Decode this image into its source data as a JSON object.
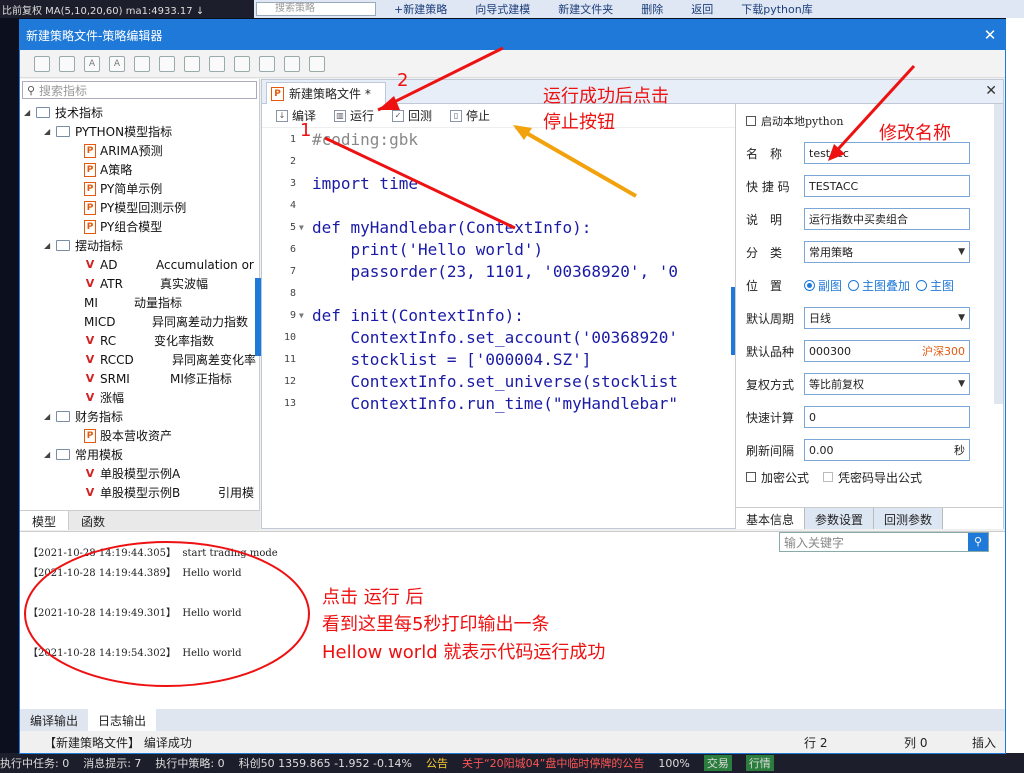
{
  "background": {
    "ticker": "比前复权 MA(5,10,20,60) ma1:4933.17 ↓",
    "search_placeholder": "搜索策略",
    "toolbar": [
      "+新建策略",
      "向导式建模",
      "新建文件夹",
      "删除",
      "返回",
      "下载python库"
    ],
    "status": [
      "执行中任务: 0",
      "消息提示: 7",
      "执行中策略: 0",
      "科创50 1359.865 -1.952 -0.14%",
      "公告",
      "关于“20阳城04”盘中临时停牌的公告",
      "100%",
      "交易",
      "行情"
    ]
  },
  "window": {
    "title": "新建策略文件-策略编辑器",
    "close_glyph": "✕"
  },
  "left": {
    "search_placeholder": "搜索指标",
    "tabs": [
      "模型",
      "函数"
    ],
    "tree": [
      {
        "label": "技术指标"
      },
      {
        "label": "PYTHON模型指标"
      },
      {
        "label": "ARIMA预测"
      },
      {
        "label": "A策略"
      },
      {
        "label": "PY简单示例"
      },
      {
        "label": "PY模型回测示例"
      },
      {
        "label": "PY组合模型"
      },
      {
        "label": "摆动指标"
      },
      {
        "label": "AD",
        "desc": "Accumulation or"
      },
      {
        "label": "ATR",
        "desc": "真实波幅"
      },
      {
        "label": "MI",
        "desc": "动量指标"
      },
      {
        "label": "MICD",
        "desc": "异同离差动力指数"
      },
      {
        "label": "RC",
        "desc": "变化率指数"
      },
      {
        "label": "RCCD",
        "desc": "异同离差变化率"
      },
      {
        "label": "SRMI",
        "desc": "MI修正指标"
      },
      {
        "label": "涨幅"
      },
      {
        "label": "财务指标"
      },
      {
        "label": "股本营收资产"
      },
      {
        "label": "常用模板"
      },
      {
        "label": "单股模型示例A"
      },
      {
        "label": "单股模型示例B",
        "desc": "引用模"
      }
    ]
  },
  "editor": {
    "file_tab": "新建策略文件 *",
    "close_glyph": "✕",
    "toolbar": {
      "compile": "编译",
      "run": "运行",
      "backtest": "回测",
      "stop": "停止"
    },
    "code": [
      {
        "n": "1",
        "t": "#coding:gbk"
      },
      {
        "n": "2",
        "t": ""
      },
      {
        "n": "3",
        "t": "import time"
      },
      {
        "n": "4",
        "t": ""
      },
      {
        "n": "5",
        "t": "def myHandlebar(ContextInfo):"
      },
      {
        "n": "6",
        "t": "    print('Hello world')"
      },
      {
        "n": "7",
        "t": "    passorder(23, 1101, '00368920', '0"
      },
      {
        "n": "8",
        "t": ""
      },
      {
        "n": "9",
        "t": "def init(ContextInfo):"
      },
      {
        "n": "10",
        "t": "    ContextInfo.set_account('00368920'"
      },
      {
        "n": "11",
        "t": "    stocklist = ['000004.SZ']"
      },
      {
        "n": "12",
        "t": "    ContextInfo.set_universe(stocklist"
      },
      {
        "n": "13",
        "t": "    ContextInfo.run_time(\"myHandlebar\""
      }
    ]
  },
  "props": {
    "local_python": "启动本地python",
    "name_label": "名　称",
    "name_value": "testacc",
    "code_label": "快 捷 码",
    "code_value": "TESTACC",
    "desc_label": "说　明",
    "desc_value": "运行指数中买卖组合",
    "category_label": "分　类",
    "category_value": "常用策略",
    "position_label": "位　置",
    "positions": [
      "副图",
      "主图叠加",
      "主图"
    ],
    "period_label": "默认周期",
    "period_value": "日线",
    "variety_label": "默认品种",
    "variety_code": "000300",
    "variety_name": "沪深300",
    "adjust_label": "复权方式",
    "adjust_value": "等比前复权",
    "fastcalc_label": "快速计算",
    "fastcalc_value": "0",
    "refresh_label": "刷新间隔",
    "refresh_value": "0.00",
    "refresh_unit": "秒",
    "encrypt": "加密公式",
    "export_cred": "凭密码导出公式",
    "tabs": [
      "基本信息",
      "参数设置",
      "回测参数"
    ]
  },
  "log": {
    "search_placeholder": "输入关键字",
    "lines": [
      "【2021-10-28 14:19:44.305】  start trading mode",
      "【2021-10-28 14:19:44.389】  Hello world",
      "【2021-10-28 14:19:49.301】  Hello world",
      "【2021-10-28 14:19:54.302】  Hello world"
    ],
    "tabs": [
      "编译输出",
      "日志输出"
    ]
  },
  "status": {
    "message": "【新建策略文件】 编译成功",
    "row": "行 2",
    "col": "列 0",
    "mode": "插入"
  },
  "annotations": {
    "step2": "2",
    "step1": "1",
    "stop_hint_1": "运行成功后点击",
    "stop_hint_2": "停止按钮",
    "rename": "修改名称",
    "log_hint_1": "点击 运行 后",
    "log_hint_2": "看到这里每5秒打印输出一条",
    "log_hint_3": "Hellow world 就表示代码运行成功"
  }
}
